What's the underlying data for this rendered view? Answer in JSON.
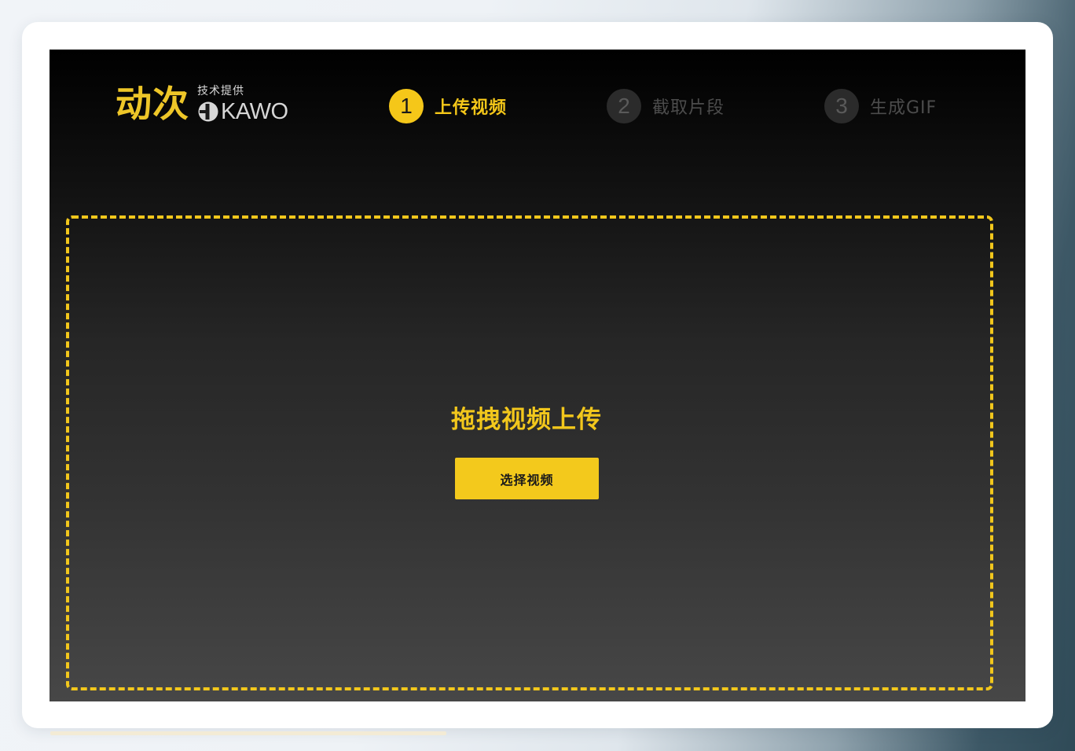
{
  "header": {
    "logo_text": "动次",
    "powered_by": "技术提供",
    "brand": "KAWO",
    "brand_icon": "kawo-logo-icon"
  },
  "steps": [
    {
      "number": "1",
      "label": "上传视频",
      "state": "active"
    },
    {
      "number": "2",
      "label": "截取片段",
      "state": "inactive"
    },
    {
      "number": "3",
      "label": "生成GIF",
      "state": "inactive"
    }
  ],
  "dropzone": {
    "title": "拖拽视频上传",
    "button_label": "选择视频"
  },
  "colors": {
    "accent": "#f3c91c",
    "inactive_circle": "#2b2b2b",
    "inactive_text": "#4c4c4c"
  }
}
